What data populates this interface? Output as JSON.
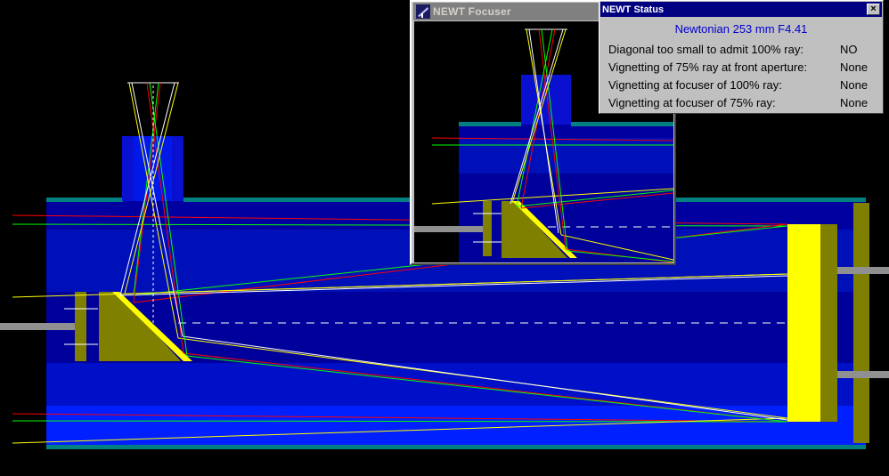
{
  "focuser_window": {
    "title": "NEWT Focuser",
    "icon": "newt-telescope-icon"
  },
  "status_window": {
    "title": "NEWT Status",
    "close_label": "×",
    "scope": "Newtonian 253 mm F4.41",
    "rows": [
      {
        "label": "Diagonal too small to admit 100% ray:",
        "value": "NO"
      },
      {
        "label": "Vignetting of 75% ray at front aperture:",
        "value": "None"
      },
      {
        "label": "Vignetting at focuser of 100% ray:",
        "value": "None"
      },
      {
        "label": "Vignetting at focuser of 75% ray:",
        "value": "None"
      }
    ]
  },
  "colors": {
    "background": "#000000",
    "tube_dark": "#0000a0",
    "tube_mid": "#0018d0",
    "tube_light": "#0020ff",
    "tube_edge": "#008080",
    "mirror": "#808000",
    "mirror_face": "#ffff00",
    "ray_red": "#ff0000",
    "ray_green": "#00ff00",
    "ray_yellow": "#ffff00",
    "ray_white": "#ffffff"
  }
}
